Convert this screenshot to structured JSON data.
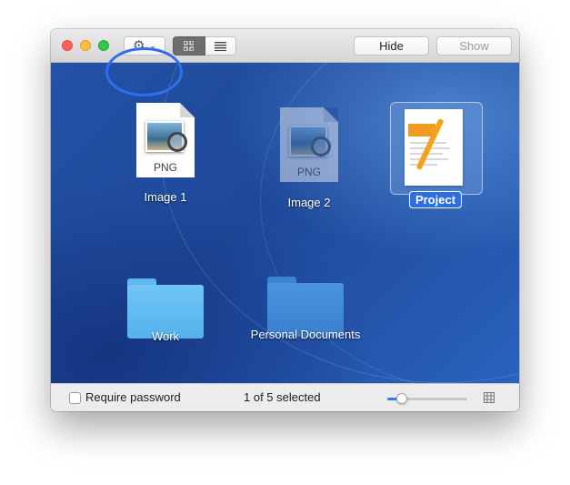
{
  "toolbar": {
    "gear_icon": "gear-icon",
    "gear_menu_chevron": "⌄",
    "view_modes": [
      "icon-view",
      "list-view"
    ],
    "selected_view": "icon-view",
    "hide_label": "Hide",
    "show_label": "Show"
  },
  "items": [
    {
      "name": "Image 1",
      "kind": "png",
      "badge": "PNG",
      "selected": false
    },
    {
      "name": "Image 2",
      "kind": "png",
      "badge": "PNG",
      "selected": false,
      "dimmed": true
    },
    {
      "name": "Project",
      "kind": "pages",
      "badge": "PAGES",
      "selected": true
    },
    {
      "name": "Work",
      "kind": "folder",
      "selected": false
    },
    {
      "name": "Personal Documents",
      "kind": "folder",
      "selected": false,
      "dimmed": true
    }
  ],
  "footer": {
    "require_password_label": "Require password",
    "require_password_checked": false,
    "status": "1 of 5 selected",
    "icon_size_slider_fraction": 0.18
  },
  "colors": {
    "accent": "#2f7cf6",
    "annotation_circle": "#2f6ef0",
    "selection_label": "#2b6fe0"
  }
}
